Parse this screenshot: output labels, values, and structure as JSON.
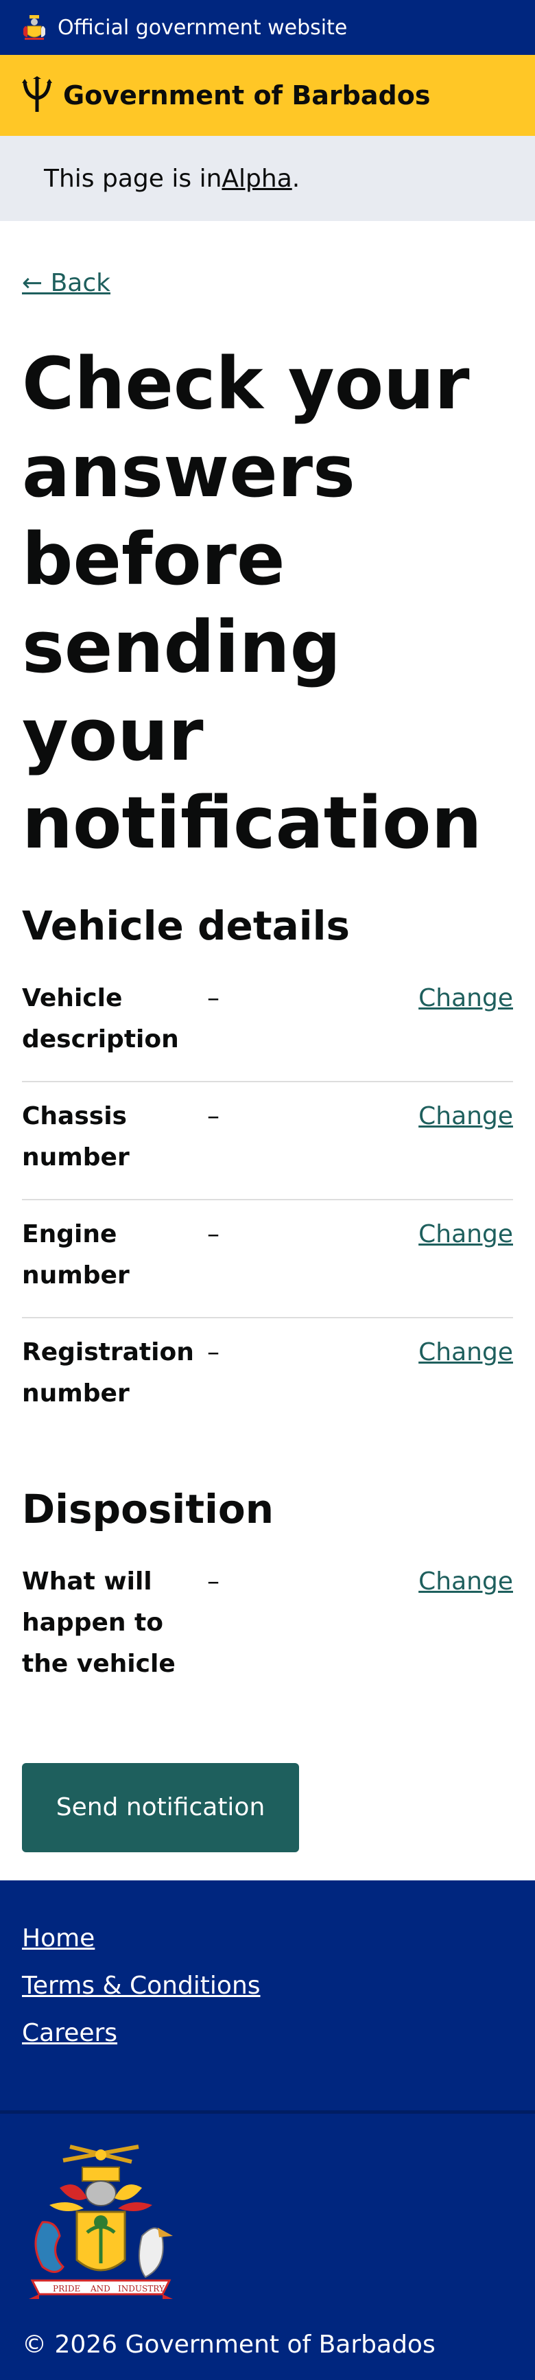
{
  "official_bar": {
    "text": "Official government website"
  },
  "header": {
    "title": "Government of Barbados"
  },
  "phase_banner": {
    "prefix": "This page is in ",
    "phase": "Alpha",
    "suffix": "."
  },
  "back_link": "← Back",
  "page_title": "Check your answers before sending your notification",
  "sections": [
    {
      "title": "Vehicle details",
      "rows": [
        {
          "key": "Vehicle description",
          "value": "–",
          "action": "Change"
        },
        {
          "key": "Chassis number",
          "value": "–",
          "action": "Change"
        },
        {
          "key": "Engine number",
          "value": "–",
          "action": "Change"
        },
        {
          "key": "Registration number",
          "value": "–",
          "action": "Change"
        }
      ]
    },
    {
      "title": "Disposition",
      "rows": [
        {
          "key": "What will happen to the vehicle",
          "value": "–",
          "action": "Change"
        }
      ]
    }
  ],
  "send_button": "Send notification",
  "footer": {
    "links": [
      "Home",
      "Terms & Conditions",
      "Careers"
    ],
    "copyright": "© 2026 Government of Barbados",
    "motto_words": [
      "PRIDE",
      "AND",
      "INDUSTRY"
    ]
  },
  "colors": {
    "navy": "#00267f",
    "gold": "#ffc726",
    "teal": "#1e5f5d",
    "phase_bg": "#e8ebf1"
  }
}
